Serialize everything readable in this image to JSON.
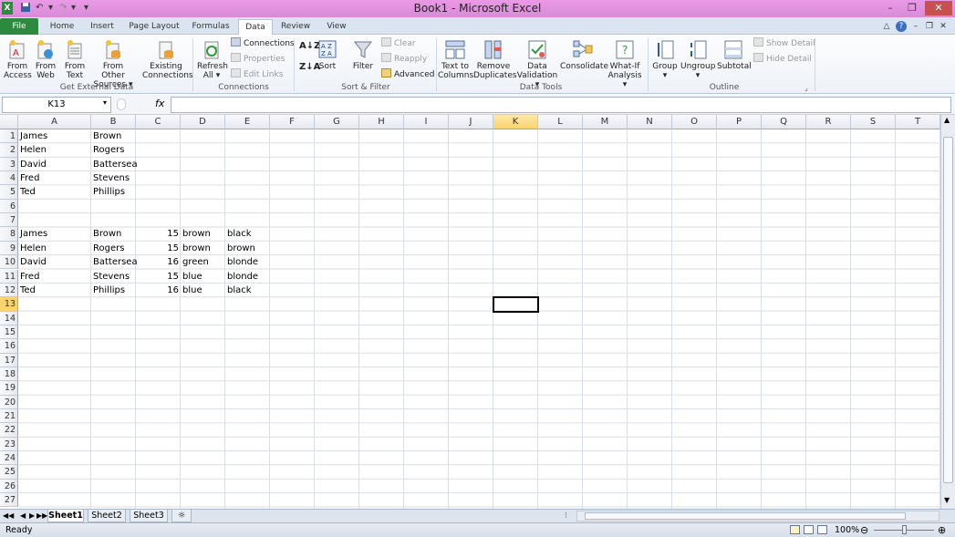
{
  "titlebar": {
    "title": "Book1 - Microsoft Excel",
    "undo_glyph": "↶",
    "redo_glyph": "↷",
    "qa_dropdown": "▾",
    "minimize": "–",
    "restore": "❐",
    "close": "✕"
  },
  "tabs": [
    {
      "label": "File"
    },
    {
      "label": "Home"
    },
    {
      "label": "Insert"
    },
    {
      "label": "Page Layout"
    },
    {
      "label": "Formulas"
    },
    {
      "label": "Data"
    },
    {
      "label": "Review"
    },
    {
      "label": "View"
    }
  ],
  "ribbon": {
    "external": {
      "group": "Get External Data",
      "from_access": [
        "From",
        "Access"
      ],
      "from_web": [
        "From",
        "Web"
      ],
      "from_text": [
        "From",
        "Text"
      ],
      "from_other": [
        "From Other",
        "Sources ▾"
      ],
      "existing": [
        "Existing",
        "Connections"
      ]
    },
    "connections": {
      "group": "Connections",
      "refresh": [
        "Refresh",
        "All ▾"
      ],
      "connections": "Connections",
      "properties": "Properties",
      "edit_links": "Edit Links"
    },
    "sortfilter": {
      "group": "Sort & Filter",
      "sort": "Sort",
      "filter": "Filter",
      "clear": "Clear",
      "reapply": "Reapply",
      "advanced": "Advanced"
    },
    "datatools": {
      "group": "Data Tools",
      "text_to_columns": [
        "Text to",
        "Columns"
      ],
      "remove_duplicates": [
        "Remove",
        "Duplicates"
      ],
      "data_validation": [
        "Data",
        "Validation ▾"
      ],
      "consolidate": "Consolidate",
      "whatif": [
        "What-If",
        "Analysis ▾"
      ]
    },
    "outline": {
      "group": "Outline",
      "group_btn": [
        "Group",
        "▾"
      ],
      "ungroup": [
        "Ungroup",
        "▾"
      ],
      "subtotal": "Subtotal",
      "show_detail": "Show Detail",
      "hide_detail": "Hide Detail"
    }
  },
  "formula_bar": {
    "name_box": "K13",
    "fx": "fx",
    "formula": ""
  },
  "grid": {
    "columns": [
      "A",
      "B",
      "C",
      "D",
      "E",
      "F",
      "G",
      "H",
      "I",
      "J",
      "K",
      "L",
      "M",
      "N",
      "O",
      "P",
      "Q",
      "R",
      "S",
      "T"
    ],
    "rows": [
      "1",
      "2",
      "3",
      "4",
      "5",
      "6",
      "7",
      "8",
      "9",
      "10",
      "11",
      "12",
      "13",
      "14",
      "15",
      "16",
      "17",
      "18",
      "19",
      "20",
      "21",
      "22",
      "23",
      "24",
      "25",
      "26",
      "27"
    ],
    "selected_cell": "K13",
    "cells": [
      {
        "row": 1,
        "col": "A",
        "value": "James"
      },
      {
        "row": 1,
        "col": "B",
        "value": "Brown"
      },
      {
        "row": 2,
        "col": "A",
        "value": "Helen"
      },
      {
        "row": 2,
        "col": "B",
        "value": "Rogers"
      },
      {
        "row": 3,
        "col": "A",
        "value": "David"
      },
      {
        "row": 3,
        "col": "B",
        "value": "Battersea"
      },
      {
        "row": 4,
        "col": "A",
        "value": "Fred"
      },
      {
        "row": 4,
        "col": "B",
        "value": "Stevens"
      },
      {
        "row": 5,
        "col": "A",
        "value": "Ted"
      },
      {
        "row": 5,
        "col": "B",
        "value": "Phillips"
      },
      {
        "row": 8,
        "col": "A",
        "value": "James"
      },
      {
        "row": 8,
        "col": "B",
        "value": "Brown"
      },
      {
        "row": 8,
        "col": "C",
        "value": "15"
      },
      {
        "row": 8,
        "col": "D",
        "value": "brown"
      },
      {
        "row": 8,
        "col": "E",
        "value": "black"
      },
      {
        "row": 9,
        "col": "A",
        "value": "Helen"
      },
      {
        "row": 9,
        "col": "B",
        "value": "Rogers"
      },
      {
        "row": 9,
        "col": "C",
        "value": "15"
      },
      {
        "row": 9,
        "col": "D",
        "value": "brown"
      },
      {
        "row": 9,
        "col": "E",
        "value": "brown"
      },
      {
        "row": 10,
        "col": "A",
        "value": "David"
      },
      {
        "row": 10,
        "col": "B",
        "value": "Battersea"
      },
      {
        "row": 10,
        "col": "C",
        "value": "16"
      },
      {
        "row": 10,
        "col": "D",
        "value": "green"
      },
      {
        "row": 10,
        "col": "E",
        "value": "blonde"
      },
      {
        "row": 11,
        "col": "A",
        "value": "Fred"
      },
      {
        "row": 11,
        "col": "B",
        "value": "Stevens"
      },
      {
        "row": 11,
        "col": "C",
        "value": "15"
      },
      {
        "row": 11,
        "col": "D",
        "value": "blue"
      },
      {
        "row": 11,
        "col": "E",
        "value": "blonde"
      },
      {
        "row": 12,
        "col": "A",
        "value": "Ted"
      },
      {
        "row": 12,
        "col": "B",
        "value": "Phillips"
      },
      {
        "row": 12,
        "col": "C",
        "value": "16"
      },
      {
        "row": 12,
        "col": "D",
        "value": "blue"
      },
      {
        "row": 12,
        "col": "E",
        "value": "black"
      }
    ]
  },
  "sheets": [
    "Sheet1",
    "Sheet2",
    "Sheet3"
  ],
  "status": {
    "ready": "Ready",
    "zoom": "100%"
  },
  "colors": {
    "title_bar": "#e196dd",
    "file_tab": "#2c8a3f",
    "selected_header": "#f9d46e"
  }
}
